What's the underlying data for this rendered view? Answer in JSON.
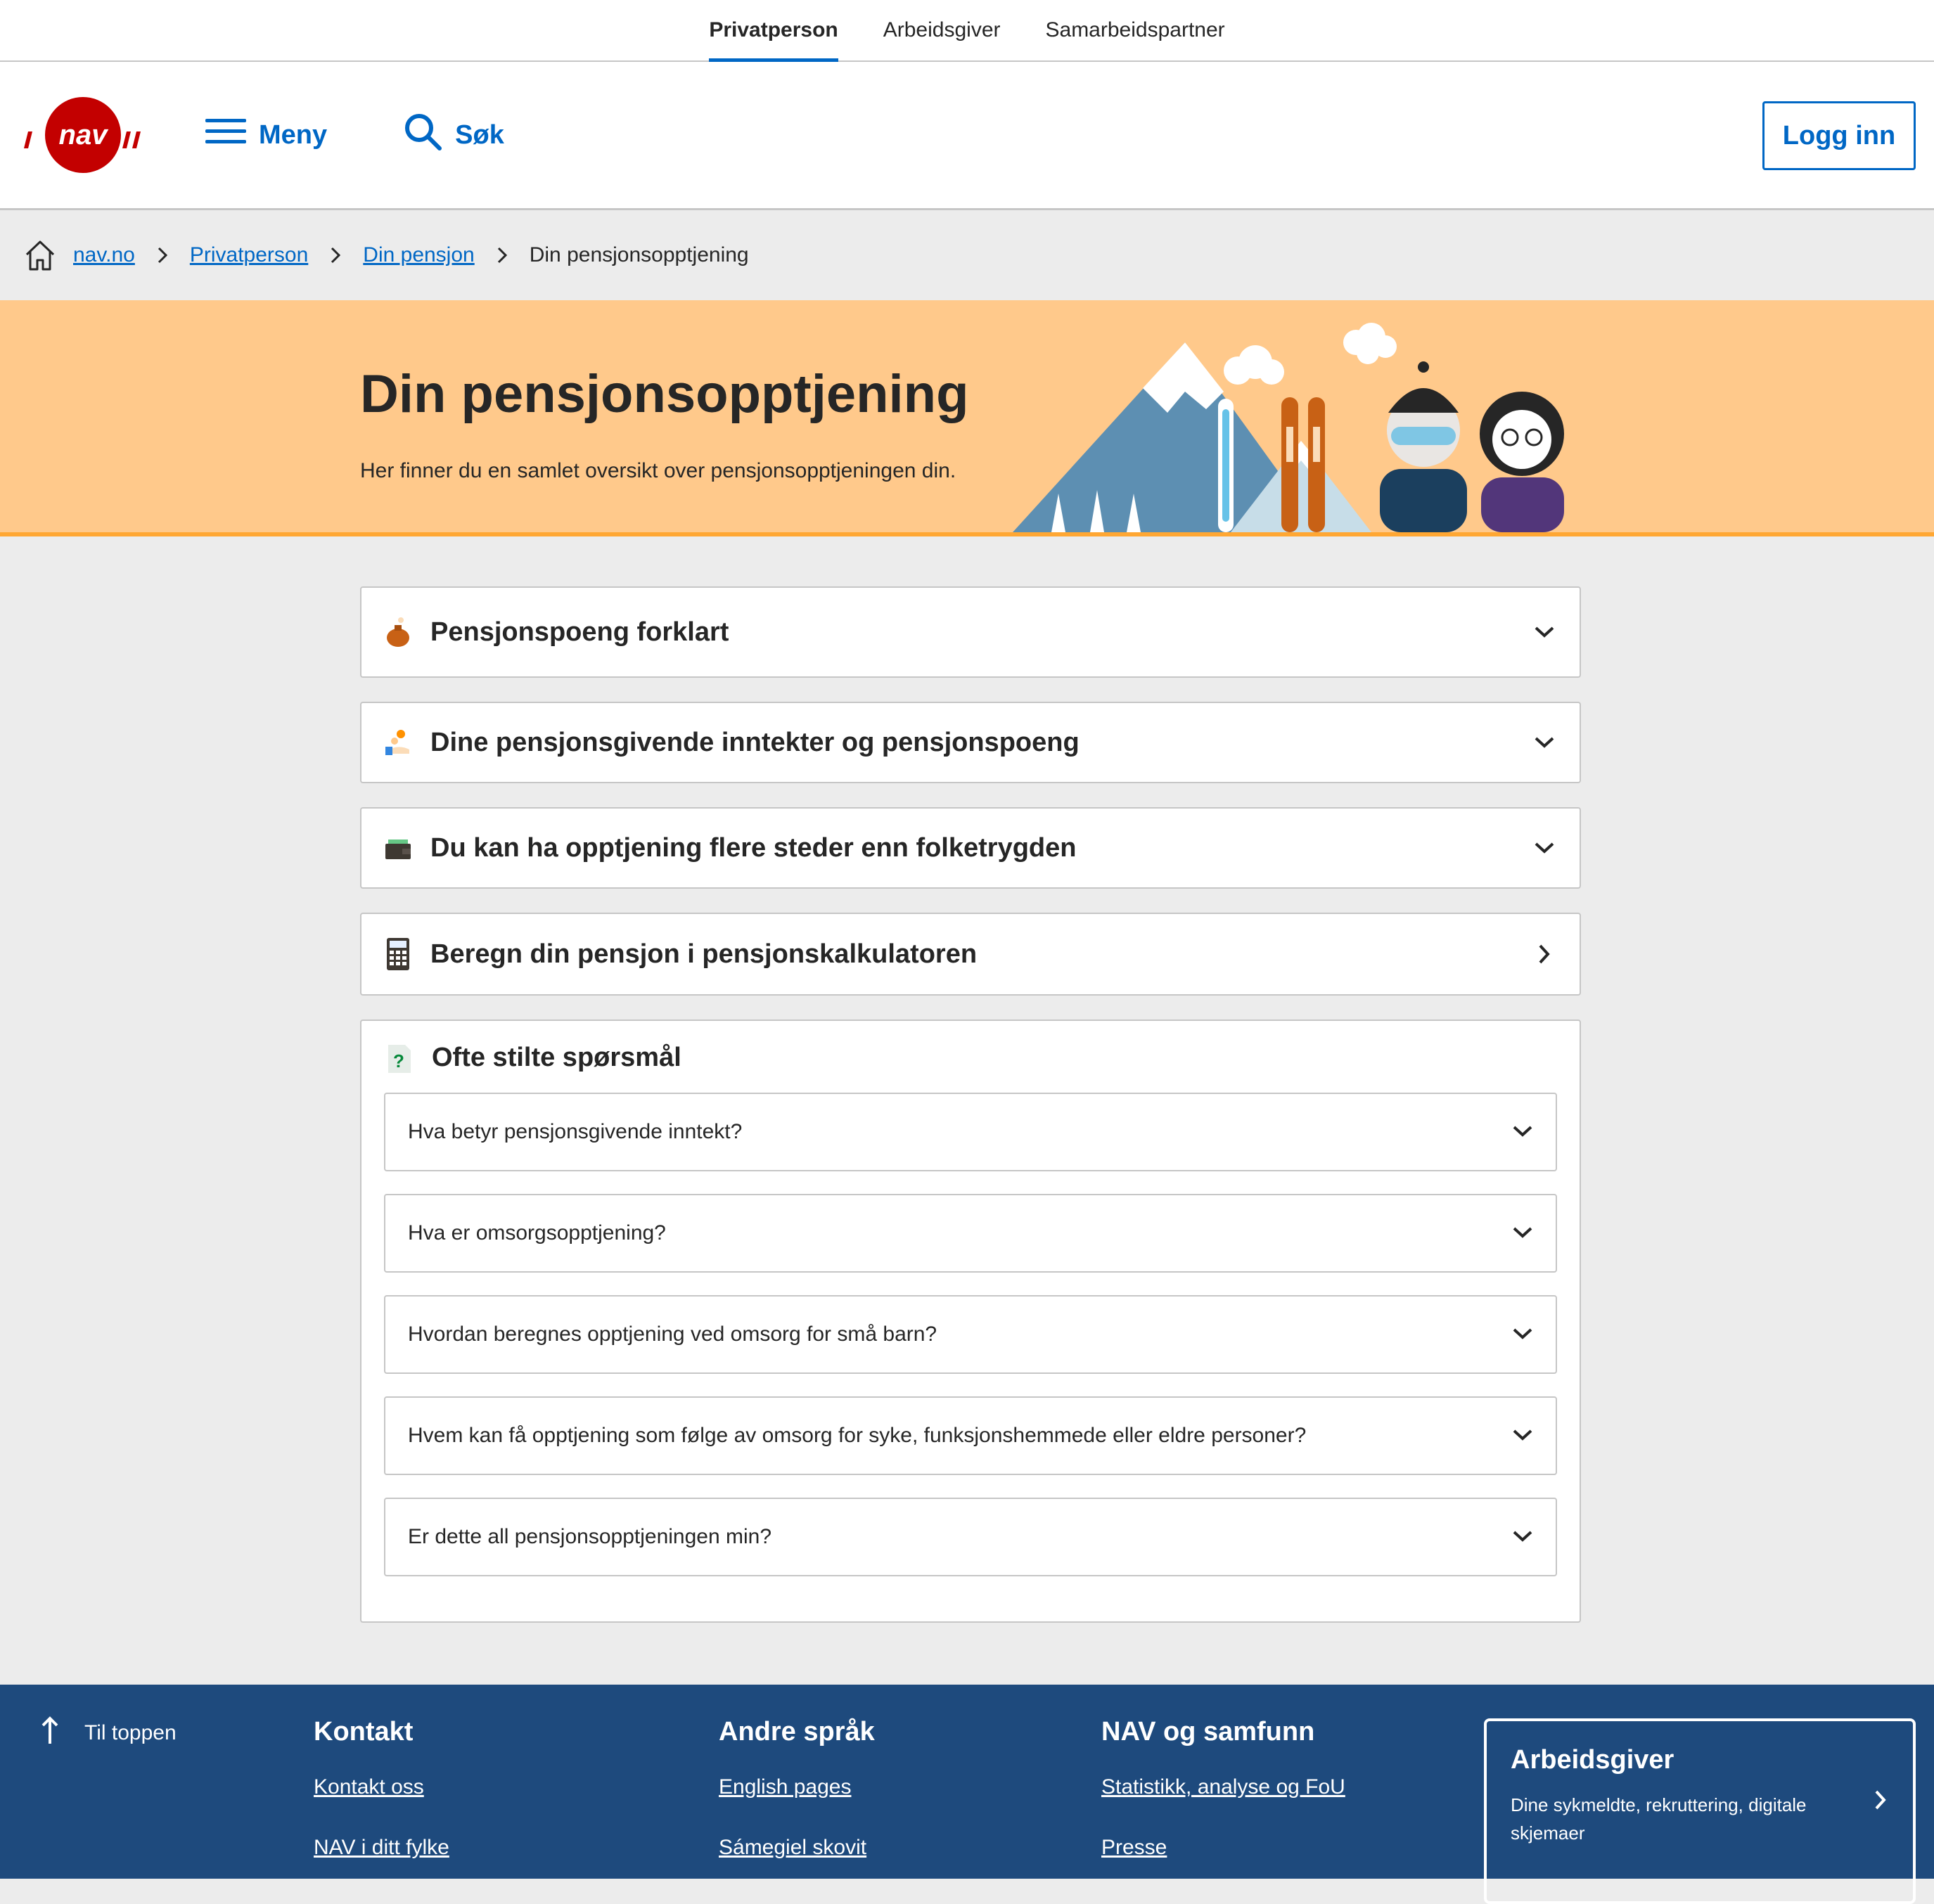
{
  "audience": {
    "tabs": [
      {
        "label": "Privatperson",
        "active": true
      },
      {
        "label": "Arbeidsgiver",
        "active": false
      },
      {
        "label": "Samarbeidspartner",
        "active": false
      }
    ]
  },
  "header": {
    "logo_text": "nav",
    "menu_label": "Meny",
    "search_label": "Søk",
    "login_label": "Logg inn"
  },
  "breadcrumb": {
    "items": [
      "nav.no",
      "Privatperson",
      "Din pensjon"
    ],
    "current": "Din pensjonsopptjening"
  },
  "hero": {
    "title": "Din pensjonsopptjening",
    "subtitle": "Her finner du en samlet oversikt over pensjonsopptjeningen din."
  },
  "panels": [
    {
      "label": "Pensjonspoeng forklart",
      "icon": "money-bag-icon",
      "chevron": "down"
    },
    {
      "label": "Dine pensjonsgivende inntekter og pensjonspoeng",
      "icon": "coins-hand-icon",
      "chevron": "down"
    },
    {
      "label": "Du kan ha opptjening flere steder enn folketrygden",
      "icon": "wallet-icon",
      "chevron": "down"
    },
    {
      "label": "Beregn din pensjon i pensjonskalkulatoren",
      "icon": "calculator-icon",
      "chevron": "right"
    }
  ],
  "faq": {
    "title": "Ofte stilte spørsmål",
    "icon": "question-document-icon",
    "items": [
      "Hva betyr pensjonsgivende inntekt?",
      "Hva er omsorgsopptjening?",
      "Hvordan beregnes opptjening ved omsorg for små barn?",
      "Hvem kan få opptjening som følge av omsorg for syke, funksjonshemmede eller eldre personer?",
      "Er dette all pensjonsopptjeningen min?"
    ]
  },
  "footer": {
    "to_top": "Til toppen",
    "columns": [
      {
        "title": "Kontakt",
        "links": [
          "Kontakt oss",
          "NAV i ditt fylke"
        ]
      },
      {
        "title": "Andre språk",
        "links": [
          "English pages",
          "Sámegiel skovit"
        ]
      },
      {
        "title": "NAV og samfunn",
        "links": [
          "Statistikk, analyse og FoU",
          "Presse"
        ]
      }
    ],
    "card": {
      "title": "Arbeidsgiver",
      "description": "Dine sykmeldte, rekruttering, digitale skjemaer"
    }
  },
  "colors": {
    "brand_red": "#c30000",
    "link_blue": "#0067c5",
    "hero_bg": "#ffc98b",
    "hero_border": "#ffa733",
    "footer_bg": "#1e4a7d",
    "page_bg": "#ececec"
  }
}
